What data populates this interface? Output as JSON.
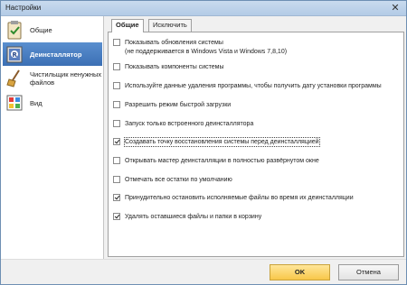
{
  "window": {
    "title": "Настройки"
  },
  "sidebar": {
    "items": [
      {
        "label": "Общие",
        "icon": "clipboard-check-icon"
      },
      {
        "label": "Деинсталлятор",
        "icon": "uninstaller-icon"
      },
      {
        "label": "Чистильщик ненужных файлов",
        "icon": "broom-icon"
      },
      {
        "label": "Вид",
        "icon": "palette-icon"
      }
    ],
    "active_index": 1
  },
  "tabs": [
    {
      "label": "Общие"
    },
    {
      "label": "Исключить"
    }
  ],
  "options": [
    {
      "line1": "Показывать обновления системы",
      "line2": "(не поддерживается в Windows Vista и Windows 7,8,10)",
      "checked": false
    },
    {
      "line1": "Показывать компоненты системы",
      "checked": false
    },
    {
      "line1": "Используйте данные удаления программы, чтобы получить дату установки программы",
      "checked": false
    },
    {
      "line1": "Разрешить режим быстрой загрузки",
      "checked": false
    },
    {
      "line1": "Запуск только встроенного деинсталлятора",
      "checked": false
    },
    {
      "line1": "Создавать точку восстановления системы перед деинсталляцией",
      "checked": true
    },
    {
      "line1": "Открывать мастер деинсталляции в полностью развёрнутом окне",
      "checked": false
    },
    {
      "line1": "Отмечать все остатки по умолчанию",
      "checked": false
    },
    {
      "line1": "Принудительно остановить исполняемые файлы во время их деинсталляции",
      "checked": true
    },
    {
      "line1": "Удалять оставшиеся файлы и папки в корзину",
      "checked": true
    }
  ],
  "footer": {
    "ok_label": "OK",
    "cancel_label": "Отмена"
  },
  "colors": {
    "ok_button": "#f8c74a",
    "active_item": "#3b6fb4"
  }
}
